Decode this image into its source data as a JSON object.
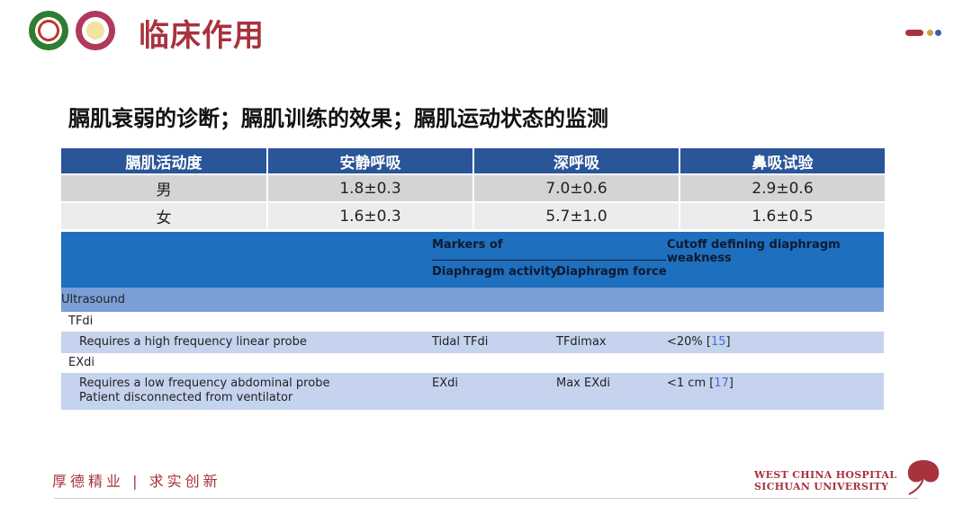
{
  "header": {
    "title": "临床作用",
    "logo1": "university-seal-icon",
    "logo2": "hospital-seal-icon"
  },
  "subtitle": "膈肌衰弱的诊断；膈肌训练的效果；膈肌运动状态的监测",
  "table1": {
    "headers": [
      "膈肌活动度",
      "安静呼吸",
      "深呼吸",
      "鼻吸试验"
    ],
    "rows": [
      [
        "男",
        "1.8±0.3",
        "7.0±0.6",
        "2.9±0.6"
      ],
      [
        "女",
        "1.6±0.3",
        "5.7±1.0",
        "1.6±0.5"
      ]
    ]
  },
  "table2": {
    "header": {
      "markers_of": "Markers of",
      "cutoff": "Cutoff defining diaphragm weakness",
      "activity": "Diaphragm activity",
      "force": "Diaphragm force"
    },
    "section": "Ultrasound",
    "sub1": {
      "name": "TFdi",
      "desc": "Requires a high frequency linear probe",
      "activity": "Tidal TFdi",
      "force": "TFdimax",
      "cutoff": "<20% [",
      "ref": "15",
      "close": "]"
    },
    "sub2": {
      "name": "EXdi",
      "desc1": "Requires a low frequency abdominal probe",
      "desc2": "Patient disconnected from ventilator",
      "activity": "EXdi",
      "force": "Max EXdi",
      "cutoff": "<1 cm [",
      "ref": "17",
      "close": "]"
    }
  },
  "footer": {
    "motto": "厚德精业 | 求实创新",
    "hospital_line1": "WEST CHINA HOSPITAL",
    "hospital_line2": "SICHUAN UNIVERSITY"
  },
  "colors": {
    "accent": "#a8323e",
    "table_header": "#2a5599",
    "table2_header": "#1f6fbf",
    "table2_section": "#7a9fd6",
    "table2_row": "#c5d3ee"
  }
}
